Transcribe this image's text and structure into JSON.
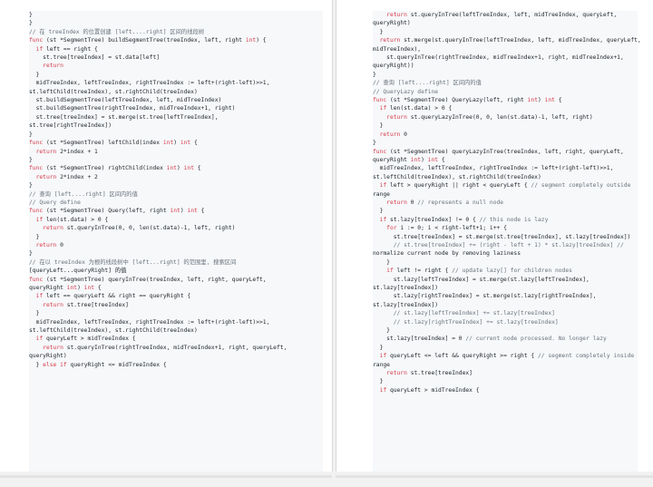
{
  "left": [
    "}",
    "}",
    "",
    "// 在 treeIndex 的位置创建 [left....right] 区间的线段树",
    "func (st *SegmentTree) buildSegmentTree(treeIndex, left, right int) {",
    "  if left == right {",
    "    st.tree[treeIndex] = st.data[left]",
    "    return",
    "  }",
    "  midTreeIndex, leftTreeIndex, rightTreeIndex := left+(right-left)>>1,",
    "st.leftChild(treeIndex), st.rightChild(treeIndex)",
    "  st.buildSegmentTree(leftTreeIndex, left, midTreeIndex)",
    "  st.buildSegmentTree(rightTreeIndex, midTreeIndex+1, right)",
    "  st.tree[treeIndex] = st.merge(st.tree[leftTreeIndex],",
    "st.tree[rightTreeIndex])",
    "}",
    "",
    "func (st *SegmentTree) leftChild(index int) int {",
    "  return 2*index + 1",
    "}",
    "",
    "func (st *SegmentTree) rightChild(index int) int {",
    "  return 2*index + 2",
    "}",
    "",
    "// 查询 [left....right] 区间内的值",
    "",
    "// Query define",
    "func (st *SegmentTree) Query(left, right int) int {",
    "  if len(st.data) > 0 {",
    "    return st.queryInTree(0, 0, len(st.data)-1, left, right)",
    "  }",
    "  return 0",
    "}",
    "",
    "// 在以 treeIndex 为根的线段树中 [left...right] 的范围里, 搜索区间",
    "[queryLeft...queryRight] 的值",
    "func (st *SegmentTree) queryInTree(treeIndex, left, right, queryLeft,",
    "queryRight int) int {",
    "  if left == queryLeft && right == queryRight {",
    "    return st.tree[treeIndex]",
    "  }",
    "  midTreeIndex, leftTreeIndex, rightTreeIndex := left+(right-left)>>1,",
    "st.leftChild(treeIndex), st.rightChild(treeIndex)",
    "  if queryLeft > midTreeIndex {",
    "    return st.queryInTree(rightTreeIndex, midTreeIndex+1, right, queryLeft,",
    "queryRight)",
    "  } else if queryRight <= midTreeIndex {"
  ],
  "right": [
    "    return st.queryInTree(leftTreeIndex, left, midTreeIndex, queryLeft,",
    "queryRight)",
    "  }",
    "  return st.merge(st.queryInTree(leftTreeIndex, left, midTreeIndex, queryLeft,",
    "midTreeIndex),",
    "    st.queryInTree(rightTreeIndex, midTreeIndex+1, right, midTreeIndex+1,",
    "queryRight))",
    "}",
    "",
    "// 查询 [left....right] 区间内的值",
    "",
    "// QueryLazy define",
    "func (st *SegmentTree) QueryLazy(left, right int) int {",
    "  if len(st.data) > 0 {",
    "    return st.queryLazyInTree(0, 0, len(st.data)-1, left, right)",
    "  }",
    "  return 0",
    "}",
    "",
    "func (st *SegmentTree) queryLazyInTree(treeIndex, left, right, queryLeft,",
    "queryRight int) int {",
    "  midTreeIndex, leftTreeIndex, rightTreeIndex := left+(right-left)>>1,",
    "st.leftChild(treeIndex), st.rightChild(treeIndex)",
    "  if left > queryRight || right < queryLeft { // segment completely outside",
    "range",
    "    return 0 // represents a null node",
    "  }",
    "  if st.lazy[treeIndex] != 0 { // this node is lazy",
    "    for i := 0; i < right-left+1; i++ {",
    "      st.tree[treeIndex] = st.merge(st.tree[treeIndex], st.lazy[treeIndex])",
    "      // st.tree[treeIndex] += (right - left + 1) * st.lazy[treeIndex] //",
    "normalize current node by removing laziness",
    "    }",
    "    if left != right { // update lazy[] for children nodes",
    "      st.lazy[leftTreeIndex] = st.merge(st.lazy[leftTreeIndex],",
    "st.lazy[treeIndex])",
    "      st.lazy[rightTreeIndex] = st.merge(st.lazy[rightTreeIndex],",
    "st.lazy[treeIndex])",
    "      // st.lazy[leftTreeIndex] += st.lazy[treeIndex]",
    "      // st.lazy[rightTreeIndex] += st.lazy[treeIndex]",
    "    }",
    "    st.lazy[treeIndex] = 0 // current node processed. No longer lazy",
    "  }",
    "  if queryLeft <= left && queryRight >= right { // segment completely inside",
    "range",
    "    return st.tree[treeIndex]",
    "  }",
    "  if queryLeft > midTreeIndex {"
  ]
}
